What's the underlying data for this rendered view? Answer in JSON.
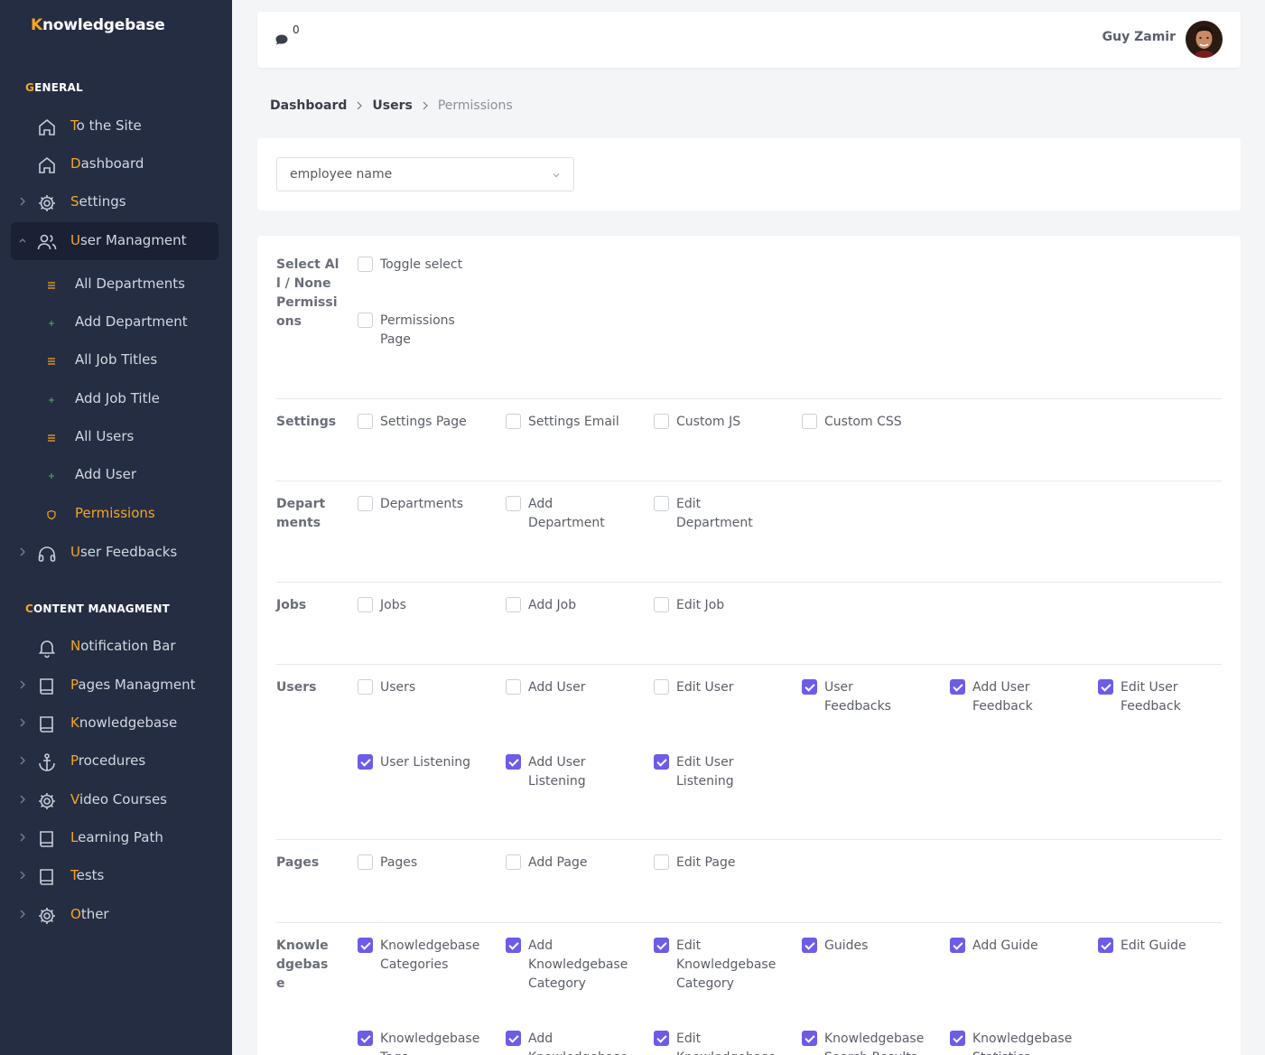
{
  "app": {
    "logo_first": "K",
    "logo_rest": "nowledgebase"
  },
  "sidebar": {
    "general_first": "G",
    "general_rest": "ENERAL",
    "content_first": "C",
    "content_rest": "ONTENT MANAGMENT",
    "items": [
      {
        "first": "T",
        "rest": "o the Site"
      },
      {
        "first": "D",
        "rest": "ashboard"
      },
      {
        "first": "S",
        "rest": "ettings"
      },
      {
        "first": "U",
        "rest": "ser Managment"
      },
      {
        "first": "U",
        "rest": "ser Feedbacks"
      },
      {
        "first": "N",
        "rest": "otification Bar"
      },
      {
        "first": "P",
        "rest": "ages Managment"
      },
      {
        "first": "K",
        "rest": "nowledgebase"
      },
      {
        "first": "P",
        "rest": "rocedures"
      },
      {
        "first": "V",
        "rest": "ideo Courses"
      },
      {
        "first": "L",
        "rest": "earning Path"
      },
      {
        "first": "T",
        "rest": "ests"
      },
      {
        "first": "O",
        "rest": "ther"
      }
    ],
    "sub": [
      "All Departments",
      "Add Department",
      "All Job Titles",
      "Add Job Title",
      "All Users",
      "Add User",
      "Permissions"
    ]
  },
  "header": {
    "notif_count": "0",
    "user_name": "Guy Zamir"
  },
  "breadcrumb": [
    "Dashboard",
    "Users",
    "Permissions"
  ],
  "select": {
    "value": "employee name"
  },
  "groups": [
    {
      "label": "Select All / None Permissions",
      "items": [
        {
          "l": "Toggle select",
          "c": false
        },
        {
          "l": "Permissions Page",
          "c": false
        }
      ]
    },
    {
      "label": "Settings",
      "items": [
        {
          "l": "Settings Page",
          "c": false
        },
        {
          "l": "Settings Email",
          "c": false
        },
        {
          "l": "Custom JS",
          "c": false
        },
        {
          "l": "Custom CSS",
          "c": false
        }
      ]
    },
    {
      "label": "Departments",
      "items": [
        {
          "l": "Departments",
          "c": false
        },
        {
          "l": "Add Department",
          "c": false
        },
        {
          "l": "Edit Department",
          "c": false
        }
      ]
    },
    {
      "label": "Jobs",
      "items": [
        {
          "l": "Jobs",
          "c": false
        },
        {
          "l": "Add Job",
          "c": false
        },
        {
          "l": "Edit Job",
          "c": false
        }
      ]
    },
    {
      "label": "Users",
      "items": [
        {
          "l": "Users",
          "c": false
        },
        {
          "l": "Add User",
          "c": false
        },
        {
          "l": "Edit User",
          "c": false
        },
        {
          "l": "User Feedbacks",
          "c": true
        },
        {
          "l": "Add User Feedback",
          "c": true
        },
        {
          "l": "Edit User Feedback",
          "c": true
        },
        {
          "l": "User Listening",
          "c": true
        },
        {
          "l": "Add User Listening",
          "c": true
        },
        {
          "l": "Edit User Listening",
          "c": true
        }
      ]
    },
    {
      "label": "Pages",
      "items": [
        {
          "l": "Pages",
          "c": false
        },
        {
          "l": "Add Page",
          "c": false
        },
        {
          "l": "Edit Page",
          "c": false
        }
      ]
    },
    {
      "label": "Knowledgebase",
      "items": [
        {
          "l": "Knowledgebase Categories",
          "c": true
        },
        {
          "l": "Add Knowledgebase Category",
          "c": true
        },
        {
          "l": "Edit Knowledgebase Category",
          "c": true
        },
        {
          "l": "Guides",
          "c": true
        },
        {
          "l": "Add Guide",
          "c": true
        },
        {
          "l": "Edit Guide",
          "c": true
        },
        {
          "l": "Knowledgebase Tags",
          "c": true
        },
        {
          "l": "Add Knowledgebase Tag",
          "c": true
        },
        {
          "l": "Edit Knowledgebase Tag",
          "c": true
        },
        {
          "l": "Knowledgebase Search Results",
          "c": true
        },
        {
          "l": "Knowledgebase Statistics",
          "c": true
        }
      ]
    }
  ],
  "colors": {
    "accent": "#f5a623",
    "sidebar": "#252d43",
    "checkbox": "#6c5ce7"
  }
}
